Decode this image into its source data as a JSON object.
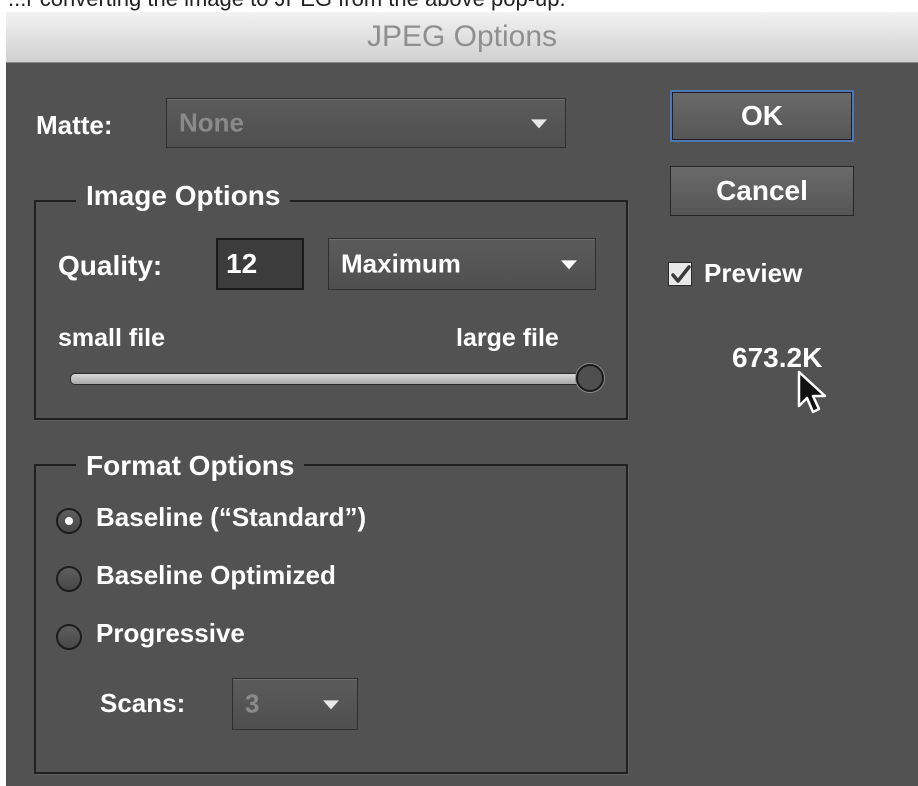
{
  "caption": "...r converting the image to JPEG from the above pop-up.",
  "dialog": {
    "title": "JPEG Options"
  },
  "matte": {
    "label": "Matte:",
    "value": "None"
  },
  "buttons": {
    "ok": "OK",
    "cancel": "Cancel"
  },
  "preview": {
    "label": "Preview",
    "checked": true,
    "file_size": "673.2K"
  },
  "image_options": {
    "legend": "Image Options",
    "quality_label": "Quality:",
    "quality_value": "12",
    "quality_preset": "Maximum",
    "small_label": "small file",
    "large_label": "large file",
    "slider_level": 1.0
  },
  "format_options": {
    "legend": "Format Options",
    "radios": [
      {
        "label": "Baseline (“Standard”)",
        "selected": true
      },
      {
        "label": "Baseline Optimized",
        "selected": false
      },
      {
        "label": "Progressive",
        "selected": false
      }
    ],
    "scans_label": "Scans:",
    "scans_value": "3"
  },
  "colors": {
    "panel": "#525252",
    "text": "#ffffff",
    "disabled_text": "#8a8a8a",
    "default_button_border": "#4a78b8"
  },
  "icons": [
    "checkmark-icon",
    "dropdown-arrow-icon",
    "mouse-pointer-icon"
  ]
}
